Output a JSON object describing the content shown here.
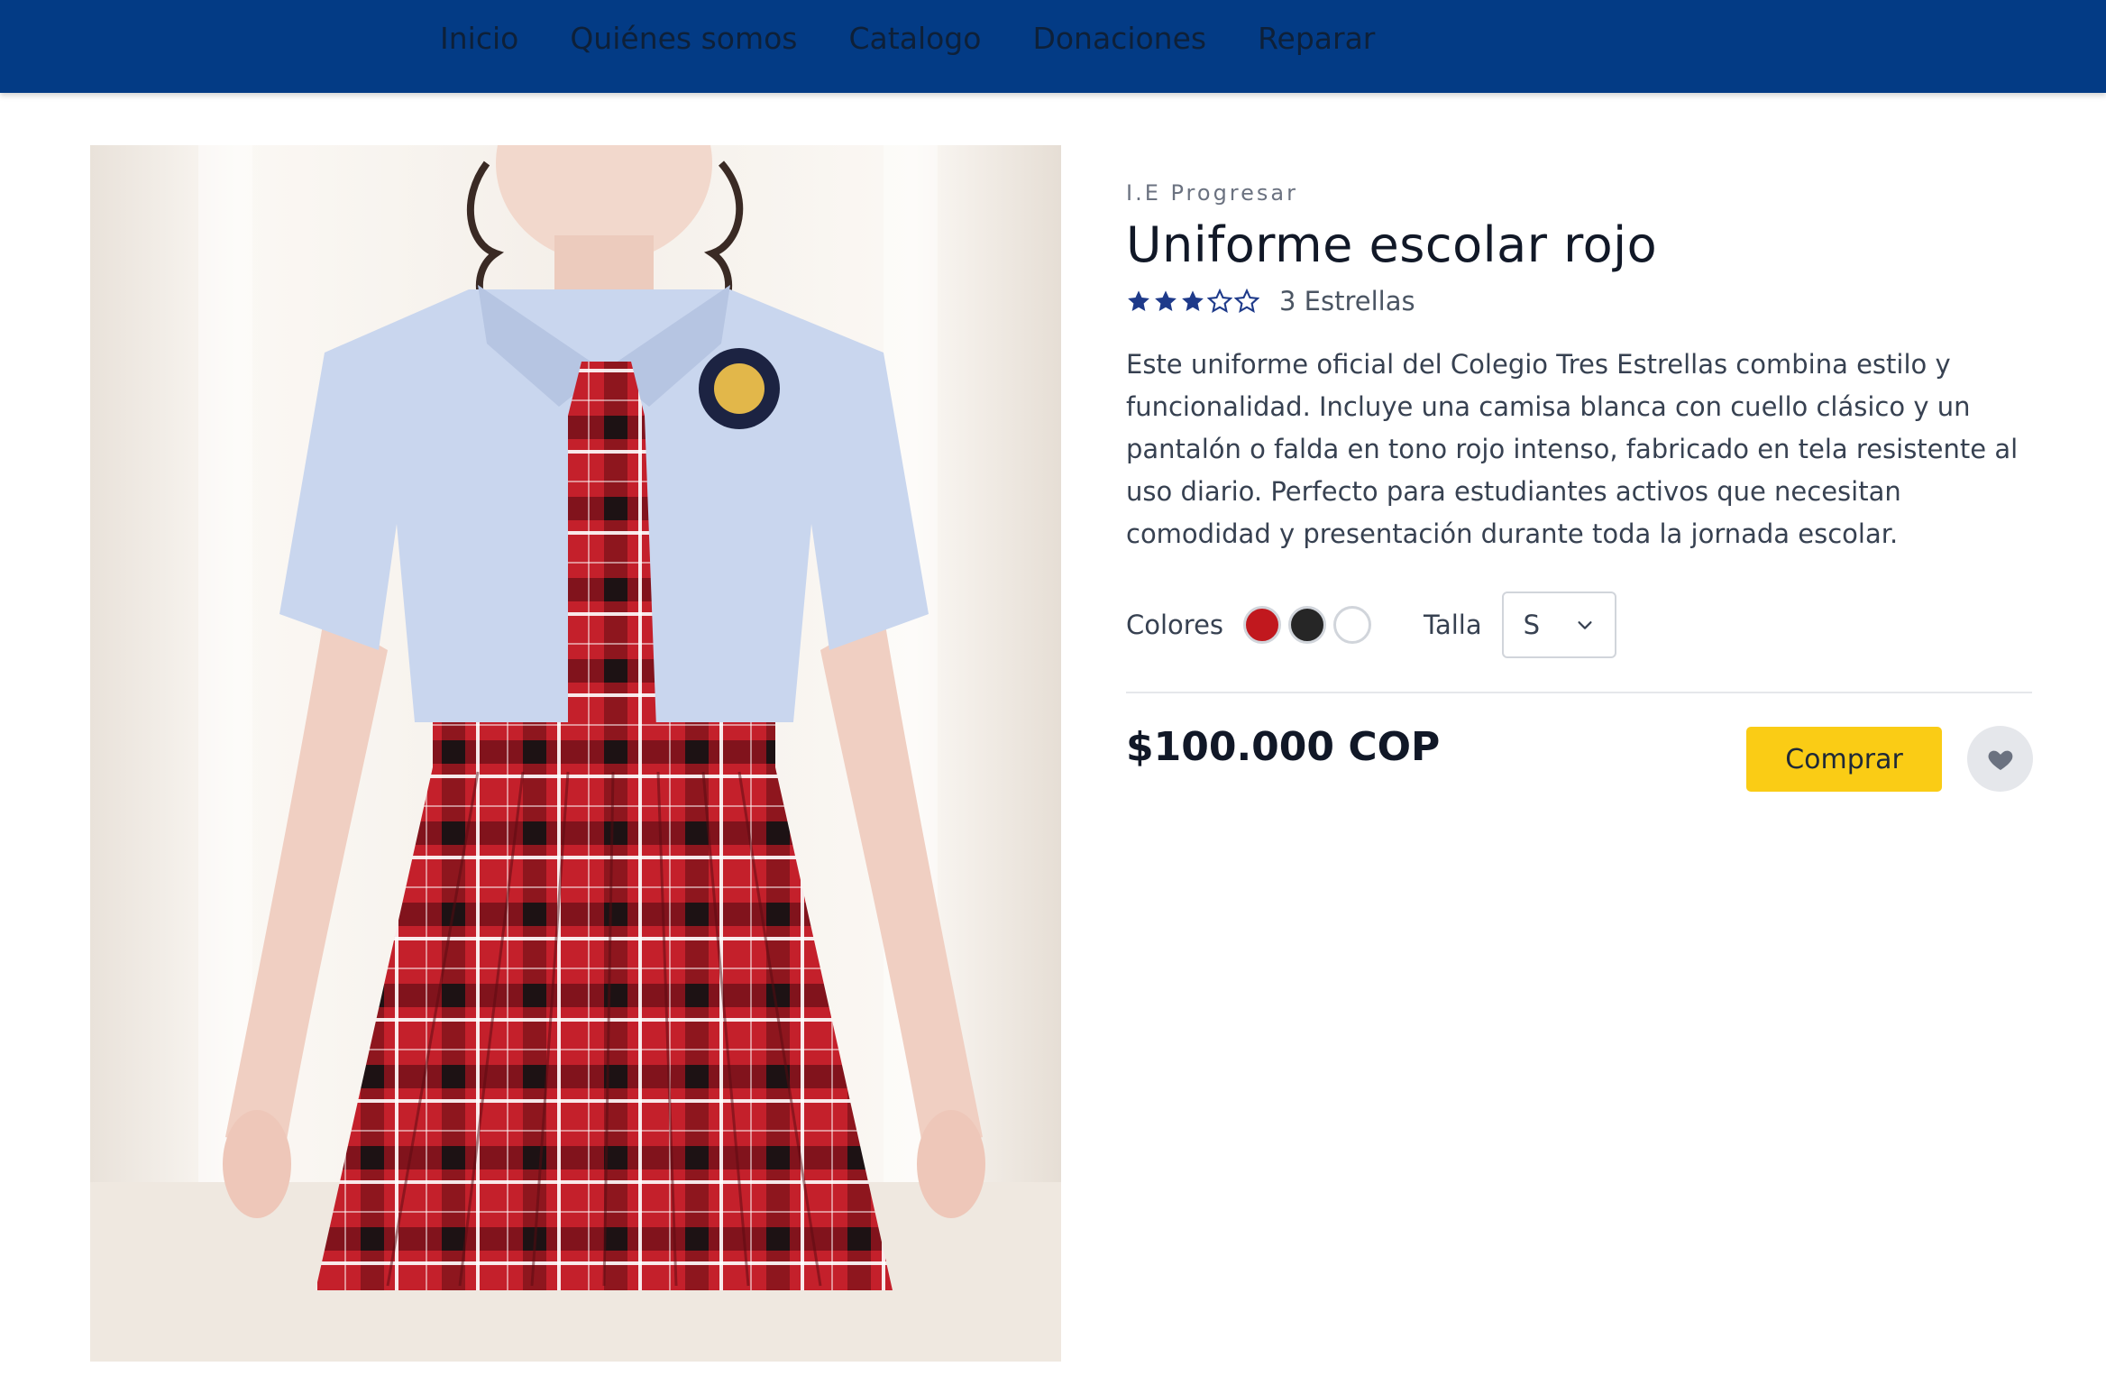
{
  "nav": {
    "items": [
      {
        "label": "Inicio"
      },
      {
        "label": "Quiénes somos"
      },
      {
        "label": "Catalogo"
      },
      {
        "label": "Donaciones"
      },
      {
        "label": "Reparar"
      }
    ]
  },
  "product": {
    "brand": "I.E Progresar",
    "title": "Uniforme escolar rojo",
    "rating": {
      "value": 3,
      "max": 5,
      "label": "3 Estrellas"
    },
    "description": "Este uniforme oficial del Colegio Tres Estrellas combina estilo y funcionalidad. Incluye una camisa blanca con cuello clásico y un pantalón o falda en tono rojo intenso, fabricado en tela resistente al uso diario. Perfecto para estudiantes activos que necesitan comodidad y presentación durante toda la jornada escolar.",
    "colors_label": "Colores",
    "colors": [
      "#c1181e",
      "#262626",
      "#ffffff"
    ],
    "size_label": "Talla",
    "size_selected": "S",
    "price": "$100.000 COP",
    "buy_label": "Comprar"
  },
  "theme": {
    "nav_bg": "#033b85",
    "accent": "#facc15",
    "star_color": "#1e3a8a"
  }
}
